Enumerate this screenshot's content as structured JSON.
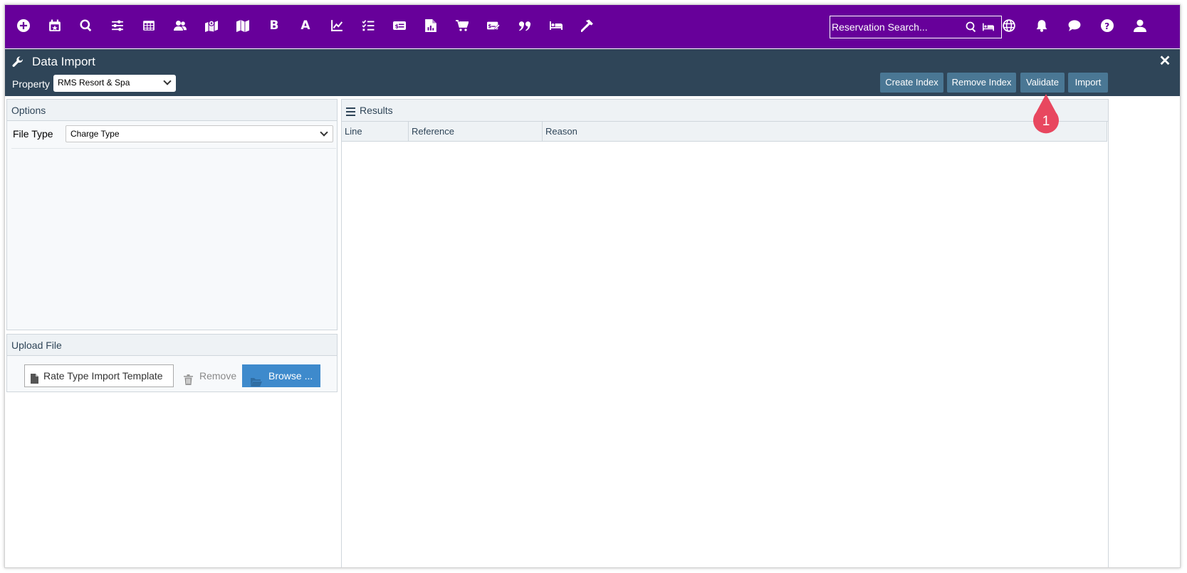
{
  "topbar": {
    "icons": [
      {
        "name": "add-icon"
      },
      {
        "name": "calendar-icon"
      },
      {
        "name": "search-icon"
      },
      {
        "name": "sliders-icon"
      },
      {
        "name": "grid-icon"
      },
      {
        "name": "users-icon"
      },
      {
        "name": "map-pin-icon"
      },
      {
        "name": "map-icon"
      },
      {
        "name": "bold-b-icon",
        "glyph": "B"
      },
      {
        "name": "letter-a-icon",
        "glyph": "A"
      },
      {
        "name": "chart-line-icon"
      },
      {
        "name": "checklist-icon"
      },
      {
        "name": "id-card-icon"
      },
      {
        "name": "report-icon"
      },
      {
        "name": "cart-icon"
      },
      {
        "name": "money-check-icon"
      },
      {
        "name": "quote-icon"
      },
      {
        "name": "bed-icon"
      },
      {
        "name": "hammer-icon"
      }
    ],
    "search_placeholder": "Reservation Search...",
    "right_icons": [
      "globe-icon",
      "bell-icon",
      "chat-icon",
      "help-icon",
      "user-icon"
    ],
    "bg_color": "#67009a"
  },
  "module": {
    "title": "Data Import",
    "property_label": "Property",
    "property_value": "RMS Resort & Spa",
    "buttons": {
      "create_index": "Create Index",
      "remove_index": "Remove Index",
      "validate": "Validate",
      "import": "Import"
    },
    "header_color": "#2f4558",
    "button_color": "#4a7794"
  },
  "options": {
    "title": "Options",
    "file_type_label": "File Type",
    "file_type_value": "Charge Type"
  },
  "upload": {
    "title": "Upload File",
    "file_name": "Rate Type Import Template",
    "remove_label": "Remove",
    "browse_label": "Browse ...",
    "browse_color": "#3e8acc"
  },
  "results": {
    "title": "Results",
    "columns": [
      "Line",
      "Reference",
      "Reason"
    ]
  },
  "callout": {
    "number": "1",
    "color": "#e8475f"
  }
}
